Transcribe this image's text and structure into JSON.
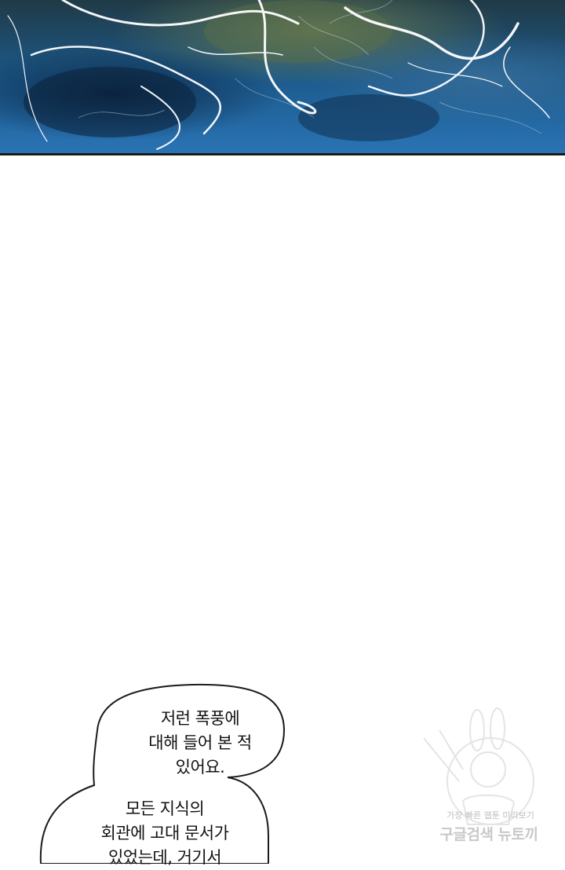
{
  "bubble_top": {
    "lines": [
      "저런 폭풍에",
      "대해 들어 본 적",
      "있어요."
    ]
  },
  "bubble_bottom": {
    "lines": [
      "모든 지식의",
      "회관에 고대 문서가",
      "있었는데, 거기서"
    ]
  },
  "watermark": {
    "tagline": "가장 빠른 웹툰 미리보기",
    "brand": "구글검색 뉴토끼"
  },
  "colors": {
    "storm_dark": "#0d2a4a",
    "storm_blue": "#1f6aa8",
    "storm_green": "#4f6a4a",
    "lightning": "#ffffff"
  }
}
